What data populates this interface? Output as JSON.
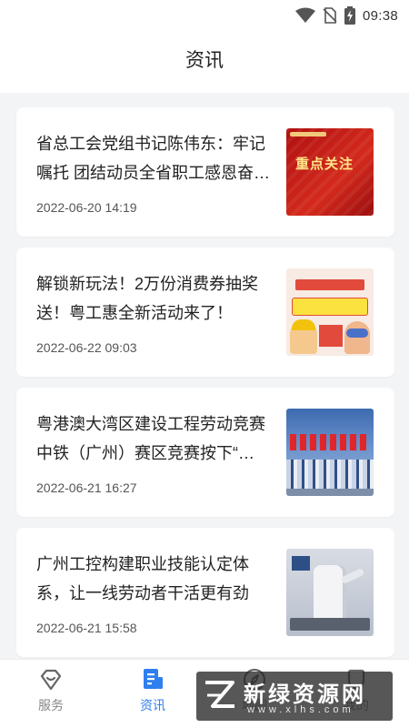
{
  "status_bar": {
    "time": "09:38",
    "icons": [
      "wifi-icon",
      "no-sim-icon",
      "battery-charging-icon"
    ]
  },
  "header": {
    "title": "资讯"
  },
  "news": [
    {
      "title": "省总工会党组书记陈伟东：牢记嘱托 团结动员全省职工感恩奋…",
      "date": "2022-06-20 14:19",
      "thumb_text": "重点关注"
    },
    {
      "title": "解锁新玩法！2万份消费券抽奖送！粤工惠全新活动来了！",
      "date": "2022-06-22 09:03"
    },
    {
      "title": "粤港澳大湾区建设工程劳动竞赛中铁（广州）赛区竞赛按下“…",
      "date": "2022-06-21 16:27"
    },
    {
      "title": "广州工控构建职业技能认定体系，让一线劳动者干活更有劲",
      "date": "2022-06-21 15:58"
    }
  ],
  "tabbar": {
    "active": "资讯",
    "items": [
      {
        "label": "服务",
        "icon": "diamond-service-icon"
      },
      {
        "label": "资讯",
        "icon": "news-document-icon"
      },
      {
        "label": "地图",
        "icon": "compass-icon"
      },
      {
        "label": "我的",
        "icon": "profile-icon"
      }
    ]
  },
  "colors": {
    "accent": "#2f7ff0",
    "background": "#f3f4f6",
    "card": "#ffffff"
  },
  "watermark": {
    "text": "新绿资源网",
    "url": "www.xlhs.com"
  }
}
